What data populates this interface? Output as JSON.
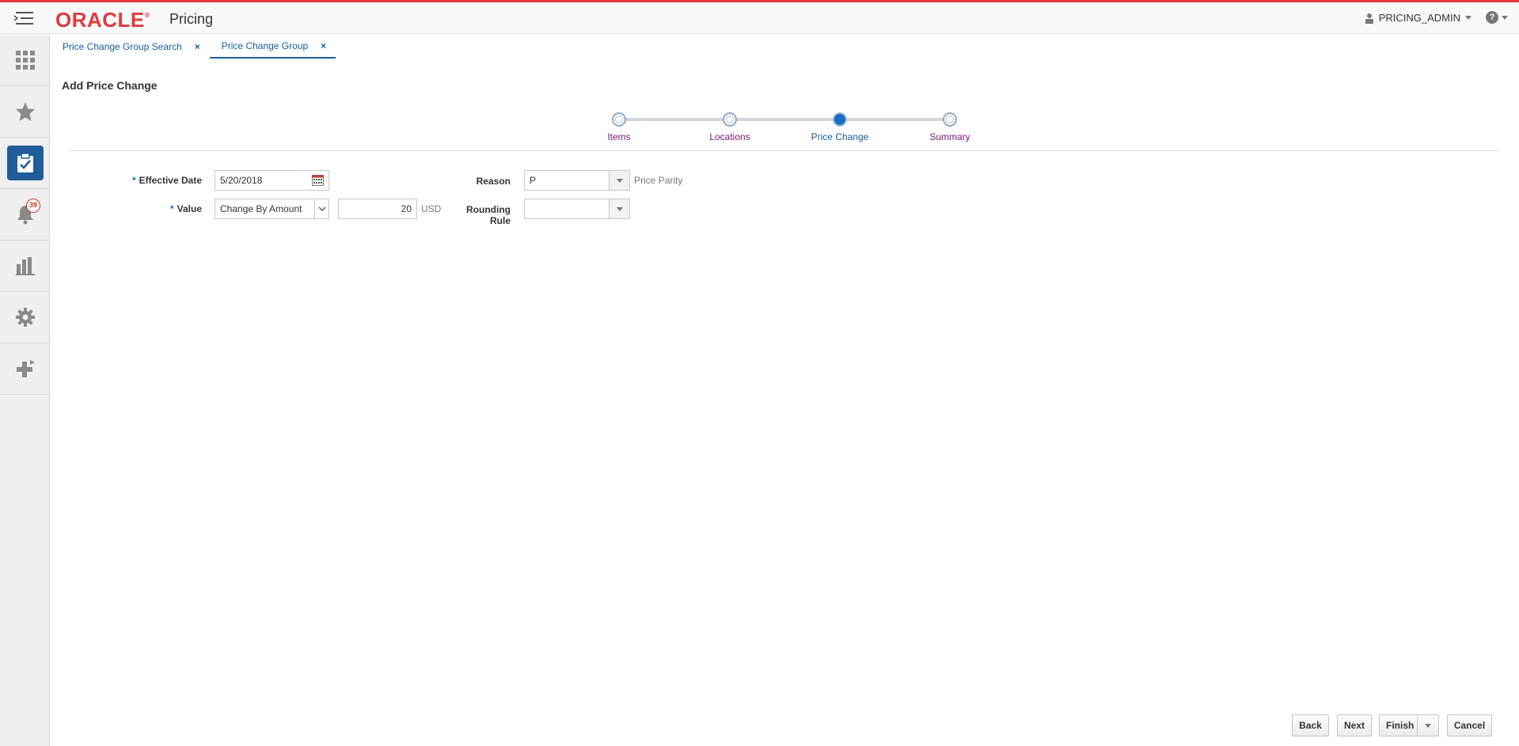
{
  "app": {
    "brand": "ORACLE",
    "name": "Pricing",
    "user": "PRICING_ADMIN",
    "brand_color": "#e03a3e",
    "accent_color": "#1f5c99"
  },
  "sidebar": {
    "items": [
      {
        "icon": "grid-icon"
      },
      {
        "icon": "star-icon"
      },
      {
        "icon": "clipboard-check-icon",
        "active": true
      },
      {
        "icon": "bell-icon",
        "badge": "39"
      },
      {
        "icon": "bar-chart-icon"
      },
      {
        "icon": "gear-icon"
      },
      {
        "icon": "plus-arrow-icon"
      }
    ]
  },
  "tabs": [
    {
      "label": "Price Change Group Search",
      "close": "×"
    },
    {
      "label": "Price Change Group",
      "close": "×",
      "active": true
    }
  ],
  "page": {
    "title": "Add Price Change"
  },
  "train": {
    "steps": [
      "Items",
      "Locations",
      "Price Change",
      "Summary"
    ],
    "current_index": 2
  },
  "form": {
    "effective_date": {
      "label": "Effective Date",
      "value": "5/20/2018",
      "required": "*"
    },
    "reason": {
      "label": "Reason",
      "value": "P",
      "description": "Price Parity"
    },
    "value": {
      "label": "Value",
      "selected": "Change By Amount",
      "amount": "20",
      "currency": "USD",
      "required": "*"
    },
    "rounding_rule": {
      "label": "Rounding Rule",
      "value": ""
    }
  },
  "actions": {
    "back": "Back",
    "next": "Next",
    "finish": "Finish",
    "cancel": "Cancel"
  }
}
